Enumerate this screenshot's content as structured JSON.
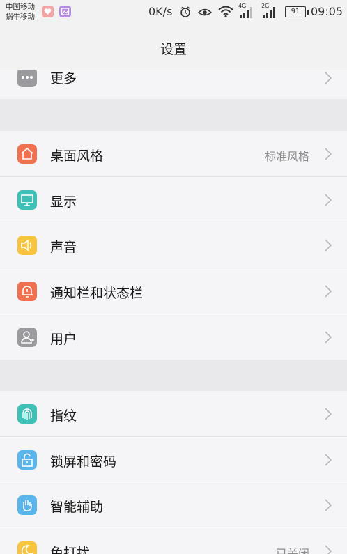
{
  "status_bar": {
    "carrier1": "中国移动",
    "carrier2": "蜗牛移动",
    "net_speed": "0K/s",
    "signal1_tag": "4G",
    "signal2_tag": "2G",
    "battery": "91",
    "time": "09:05"
  },
  "header": {
    "title": "设置"
  },
  "groups": [
    {
      "items": [
        {
          "label": "更多",
          "icon": "more-dots-icon",
          "color": "#9a9a9f"
        }
      ]
    },
    {
      "items": [
        {
          "label": "桌面风格",
          "value": "标准风格",
          "icon": "home-icon",
          "color": "#f07150"
        },
        {
          "label": "显示",
          "icon": "display-icon",
          "color": "#3fc0b6"
        },
        {
          "label": "声音",
          "icon": "speaker-icon",
          "color": "#f6c43e"
        },
        {
          "label": "通知栏和状态栏",
          "icon": "bell-icon",
          "color": "#f07150"
        },
        {
          "label": "用户",
          "icon": "user-icon",
          "color": "#9a9a9f"
        }
      ]
    },
    {
      "items": [
        {
          "label": "指纹",
          "icon": "fingerprint-icon",
          "color": "#3fc0b6"
        },
        {
          "label": "锁屏和密码",
          "icon": "lock-icon",
          "color": "#5bb5ea"
        },
        {
          "label": "智能辅助",
          "icon": "hand-icon",
          "color": "#5bb5ea"
        },
        {
          "label": "免打扰",
          "value": "已关闭",
          "icon": "moon-icon",
          "color": "#f6c43e"
        }
      ]
    }
  ]
}
